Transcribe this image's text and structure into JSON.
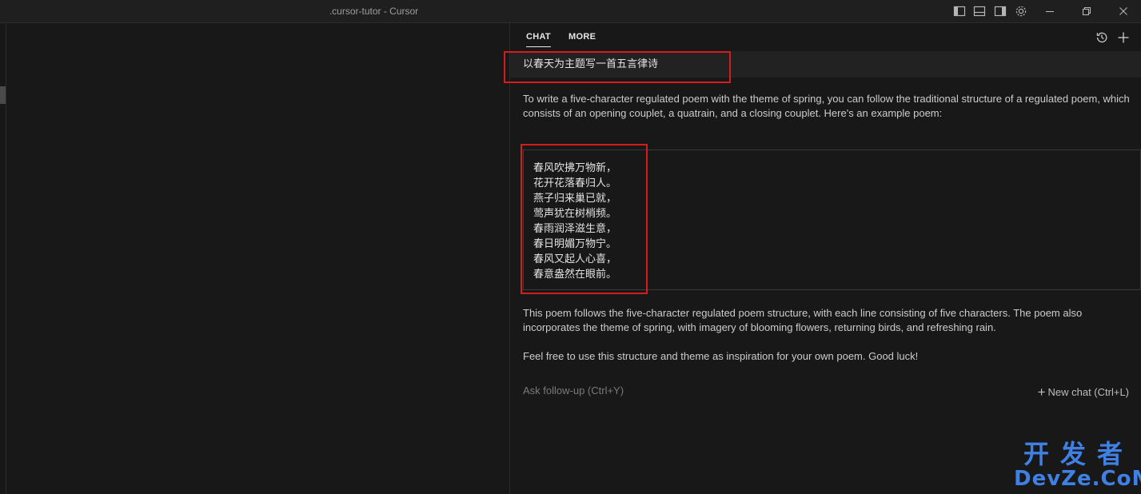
{
  "window": {
    "title": ".cursor-tutor - Cursor"
  },
  "titlebar_icons": [
    "toggle-primary-sidebar-icon",
    "toggle-panel-icon",
    "toggle-secondary-sidebar-icon",
    "gear-icon",
    "minimize-icon",
    "restore-icon",
    "close-icon"
  ],
  "chat": {
    "tabs": [
      {
        "label": "CHAT",
        "active": true
      },
      {
        "label": "MORE",
        "active": false
      }
    ],
    "header_icons": [
      "history-icon",
      "plus-icon"
    ],
    "user_message": "以春天为主题写一首五言律诗",
    "response_intro": "To write a five-character regulated poem with the theme of spring, you can follow the traditional structure of a regulated poem, which consists of an opening couplet, a quatrain, and a closing couplet. Here's an example poem:",
    "poem_lines": [
      "春风吹拂万物新，",
      "花开花落春归人。",
      "燕子归来巢已就，",
      "莺声犹在树梢频。",
      "春雨润泽滋生意，",
      "春日明媚万物宁。",
      "春风又起人心喜，",
      "春意盎然在眼前。"
    ],
    "response_explanation": "This poem follows the five-character regulated poem structure, with each line consisting of five characters. The poem also incorporates the theme of spring, with imagery of blooming flowers, returning birds, and refreshing rain.",
    "response_closing": "Feel free to use this structure and theme as inspiration for your own poem. Good luck!",
    "followup_placeholder": "Ask follow-up (Ctrl+Y)",
    "new_chat_label": "New chat (Ctrl+L)"
  },
  "watermark": {
    "line1": "开发者",
    "line2": "DevZe.CoM"
  },
  "colors": {
    "background": "#181818",
    "highlight_box": "#d81c1c",
    "watermark": "#3f80e2"
  }
}
